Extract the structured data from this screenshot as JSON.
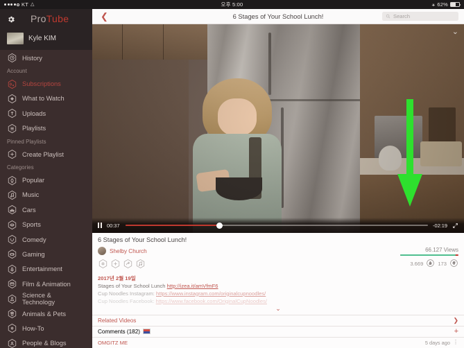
{
  "status_bar": {
    "carrier": "KT",
    "signal_icon": "signal-dots-icon",
    "wifi_icon": "wifi-icon",
    "time": "오후 5:00",
    "bluetooth_icon": "bluetooth-icon",
    "battery_percent": "62%",
    "battery_level": 62
  },
  "sidebar": {
    "settings_icon": "gear-icon",
    "brand_part1": "Pro",
    "brand_part2": "Tube",
    "user": {
      "name": "Kyle KIM",
      "avatar_icon": "avatar"
    },
    "items": [
      {
        "label": "History",
        "icon": "clock-icon",
        "type": "item",
        "active": false
      },
      {
        "label": "Account",
        "type": "section"
      },
      {
        "label": "Subscriptions",
        "icon": "subscriptions-icon",
        "type": "item",
        "active": true
      },
      {
        "label": "What to Watch",
        "icon": "compass-icon",
        "type": "item",
        "active": false
      },
      {
        "label": "Uploads",
        "icon": "upload-arrow-icon",
        "type": "item",
        "active": false
      },
      {
        "label": "Playlists",
        "icon": "list-icon",
        "type": "item",
        "active": false
      },
      {
        "label": "Pinned Playlists",
        "type": "section"
      },
      {
        "label": "Create Playlist",
        "icon": "plus-icon",
        "type": "item",
        "active": false
      },
      {
        "label": "Categories",
        "type": "section"
      },
      {
        "label": "Popular",
        "icon": "flame-icon",
        "type": "item",
        "active": false
      },
      {
        "label": "Music",
        "icon": "music-note-icon",
        "type": "item",
        "active": false
      },
      {
        "label": "Cars",
        "icon": "car-icon",
        "type": "item",
        "active": false
      },
      {
        "label": "Sports",
        "icon": "sports-icon",
        "type": "item",
        "active": false
      },
      {
        "label": "Comedy",
        "icon": "comedy-mask-icon",
        "type": "item",
        "active": false
      },
      {
        "label": "Gaming",
        "icon": "gamepad-icon",
        "type": "item",
        "active": false
      },
      {
        "label": "Entertainment",
        "icon": "microphone-icon",
        "type": "item",
        "active": false
      },
      {
        "label": "Film & Animation",
        "icon": "clapboard-icon",
        "type": "item",
        "active": false
      },
      {
        "label": "Science & Technology",
        "icon": "flask-icon",
        "type": "item",
        "active": false
      },
      {
        "label": "Animals & Pets",
        "icon": "paw-icon",
        "type": "item",
        "active": false
      },
      {
        "label": "How-To",
        "icon": "wrench-icon",
        "type": "item",
        "active": false
      },
      {
        "label": "People & Blogs",
        "icon": "people-icon",
        "type": "item",
        "active": false
      }
    ]
  },
  "topbar": {
    "back_icon": "chevron-left-icon",
    "title": "6 Stages of Your School Lunch!",
    "search": {
      "placeholder": "Search",
      "value": "",
      "icon": "search-icon"
    }
  },
  "player": {
    "collapse_icon": "chevron-down-icon",
    "play_state_icon": "pause-icon",
    "elapsed": "00:37",
    "remaining": "-02:19",
    "progress_percent": 31,
    "fullscreen_icon": "expand-icon",
    "overlay_annotation": {
      "icon": "green-down-arrow",
      "color": "#2ee02e"
    }
  },
  "video_info": {
    "title": "6 Stages of Your School Lunch!",
    "channel": "Shelby Church",
    "views": "66.127 Views",
    "likes": "3.669",
    "dislikes": "173",
    "like_icon": "thumbs-up-icon",
    "dislike_icon": "thumbs-down-icon",
    "like_ratio_percent": 95,
    "actions": [
      {
        "name": "settings-action",
        "icon": "gear-icon"
      },
      {
        "name": "add-action",
        "icon": "plus-icon"
      },
      {
        "name": "share-action",
        "icon": "share-icon"
      },
      {
        "name": "music-action",
        "icon": "music-note-icon"
      }
    ],
    "description": {
      "date": "2017년 2월 19일",
      "line1_text": "Stages of Your School Lunch ",
      "line1_link": "http://izea.it/amVfmF6",
      "line2_text": "Cup Noodles Instagram: ",
      "line2_link": "https://www.instagram.com/originalcupnoodles/",
      "line3_text": "Cup Noodles Facebook: ",
      "line3_link": "https://www.facebook.com/OriginalCupNoodles/",
      "expand_icon": "chevron-down-icon"
    }
  },
  "sections": {
    "related_videos_label": "Related Videos",
    "related_videos_chevron": "chevron-right-icon",
    "comments_label": "Comments (182)",
    "comments_flag_icon": "korean-flag-icon",
    "comments_add_icon": "plus-icon",
    "first_comment": {
      "user": "OMGITZ ME",
      "time": "5 days ago",
      "more_icon": "vertical-dots-icon"
    }
  },
  "colors": {
    "accent_red": "#c0392f",
    "sidebar_bg": "#3b2d2d",
    "annotation_green": "#2ee02e"
  }
}
